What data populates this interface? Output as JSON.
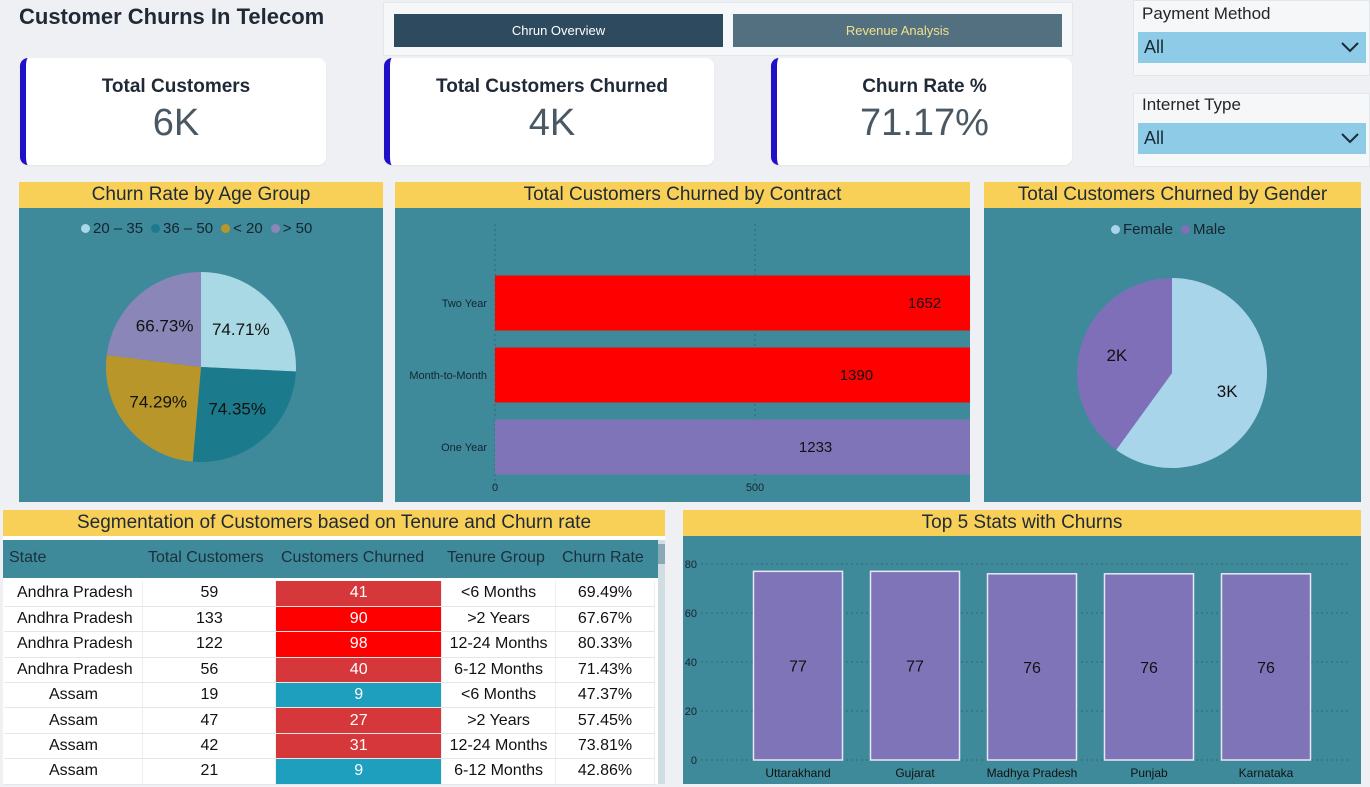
{
  "page": {
    "title": "Customer Churns In Telecom"
  },
  "nav": {
    "overview_label": "Chrun Overview",
    "revenue_label": "Revenue Analysis"
  },
  "kpis": [
    {
      "label": "Total Customers",
      "value": "6K"
    },
    {
      "label": "Total Customers Churned",
      "value": "4K"
    },
    {
      "label": "Churn Rate %",
      "value": "71.17%"
    }
  ],
  "slicers": {
    "payment": {
      "label": "Payment Method",
      "value": "All"
    },
    "internet": {
      "label": "Internet Type",
      "value": "All"
    }
  },
  "colors": {
    "header": "#f8cf57",
    "card_bg": "#3e8a9b",
    "bar_red": "#ff0000",
    "bar_purple": "#8074b9",
    "kpi_accent": "#2010c8"
  },
  "age_chart": {
    "title": "Churn Rate by Age Group",
    "legend": [
      {
        "name": "20 – 35",
        "color": "#a9d9e4"
      },
      {
        "name": "36 – 50",
        "color": "#1b7a8c"
      },
      {
        "name": "< 20",
        "color": "#b9962a"
      },
      {
        "name": "> 50",
        "color": "#8a87b8"
      }
    ],
    "slice_labels": [
      "74.71%",
      "74.35%",
      "74.29%",
      "66.73%"
    ]
  },
  "contract_chart": {
    "title": "Total Customers Churned by Contract",
    "categories": [
      "Two Year",
      "Month-to-Month",
      "One Year"
    ],
    "value_labels": [
      "1652",
      "1390",
      "1233"
    ],
    "x_ticks": [
      "0",
      "500",
      "1000",
      "1500"
    ]
  },
  "gender_chart": {
    "title": "Total Customers Churned by Gender",
    "legend": [
      {
        "name": "Female",
        "color": "#a9d5ea"
      },
      {
        "name": "Male",
        "color": "#7f6fb8"
      }
    ],
    "slice_labels": [
      "3K",
      "2K"
    ]
  },
  "segmentation": {
    "title": "Segmentation of Customers based on Tenure and Churn rate",
    "columns": [
      "State",
      "Total Customers",
      "Customers Churned",
      "Tenure Group",
      "Churn Rate"
    ],
    "rows": [
      {
        "state": "Andhra Pradesh",
        "total": "59",
        "churned": "41",
        "tenure": "<6 Months",
        "rate": "69.49%",
        "tone": "dark"
      },
      {
        "state": "Andhra Pradesh",
        "total": "133",
        "churned": "90",
        "tenure": ">2 Years",
        "rate": "67.67%",
        "tone": "red"
      },
      {
        "state": "Andhra Pradesh",
        "total": "122",
        "churned": "98",
        "tenure": "12-24 Months",
        "rate": "80.33%",
        "tone": "red"
      },
      {
        "state": "Andhra Pradesh",
        "total": "56",
        "churned": "40",
        "tenure": "6-12 Months",
        "rate": "71.43%",
        "tone": "dark"
      },
      {
        "state": "Assam",
        "total": "19",
        "churned": "9",
        "tenure": "<6 Months",
        "rate": "47.37%",
        "tone": "blue"
      },
      {
        "state": "Assam",
        "total": "47",
        "churned": "27",
        "tenure": ">2 Years",
        "rate": "57.45%",
        "tone": "dark"
      },
      {
        "state": "Assam",
        "total": "42",
        "churned": "31",
        "tenure": "12-24 Months",
        "rate": "73.81%",
        "tone": "dark"
      },
      {
        "state": "Assam",
        "total": "21",
        "churned": "9",
        "tenure": "6-12 Months",
        "rate": "42.86%",
        "tone": "blue"
      }
    ]
  },
  "states_chart": {
    "title": "Top 5 Stats with Churns",
    "y_ticks": [
      "0",
      "20",
      "40",
      "60",
      "80"
    ]
  },
  "chart_data": [
    {
      "type": "pie",
      "title": "Churn Rate by Age Group",
      "categories": [
        "20 – 35",
        "36 – 50",
        "< 20",
        "> 50"
      ],
      "values": [
        74.71,
        74.35,
        74.29,
        66.73
      ]
    },
    {
      "type": "bar",
      "title": "Total Customers Churned by Contract",
      "categories": [
        "Two Year",
        "Month-to-Month",
        "One Year"
      ],
      "values": [
        1652,
        1390,
        1233
      ],
      "xlim": [
        0,
        1650
      ],
      "grid": true
    },
    {
      "type": "pie",
      "title": "Total Customers Churned by Gender",
      "categories": [
        "Female",
        "Male"
      ],
      "values": [
        3000,
        2000
      ]
    },
    {
      "type": "bar",
      "title": "Top 5 Stats with Churns",
      "categories": [
        "Uttarakhand",
        "Gujarat",
        "Madhya Pradesh",
        "Punjab",
        "Karnataka"
      ],
      "values": [
        77,
        77,
        76,
        76,
        76
      ],
      "ylim": [
        0,
        85
      ],
      "grid": true
    }
  ]
}
